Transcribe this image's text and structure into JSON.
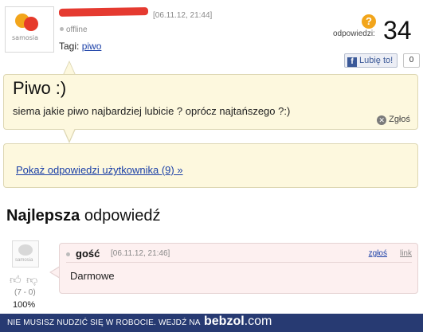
{
  "question": {
    "date": "[06.11.12, 21:44]",
    "status": "offline",
    "tags_label": "Tagi:",
    "tag": "piwo",
    "answers_label": "odpowiedzi:",
    "answers_count": "34",
    "like_label": "Lubię to!",
    "like_count": "0",
    "title": "Piwo :)",
    "body": "siema jakie piwo najbardziej lubicie ? oprócz najtańszego ?:)",
    "report": "Zgłoś"
  },
  "user_answers_link": "Pokaż odpowiedzi użytkownika (9) »",
  "best": {
    "heading_bold": "Najlepsza",
    "heading_rest": " odpowiedź",
    "author": "gość",
    "date": "[06.11.12, 21:46]",
    "report": "zgłoś",
    "link": "link",
    "body": "Darmowe",
    "votes": "(7 - 0)",
    "percent": "100%"
  },
  "footer": {
    "text": "NIE MUSISZ NUDZIĆ SIĘ W ROBOCIE. WEJDŹ NA",
    "brand": "bebzol",
    "brand_suffix": ".com"
  },
  "logo": {
    "text": "samosia"
  },
  "icons": {
    "answers": "question-bubble-icon",
    "report": "close-circle-icon",
    "facebook": "facebook-icon",
    "thumb_up": "thumb-up-icon",
    "thumb_down": "thumb-down-icon"
  },
  "colors": {
    "question_bg": "#fdf8de",
    "answer_bg": "#fdf0f0",
    "link": "#1a3fa7",
    "footer_bg": "#273a72",
    "answers_icon": "#f2a51b"
  }
}
